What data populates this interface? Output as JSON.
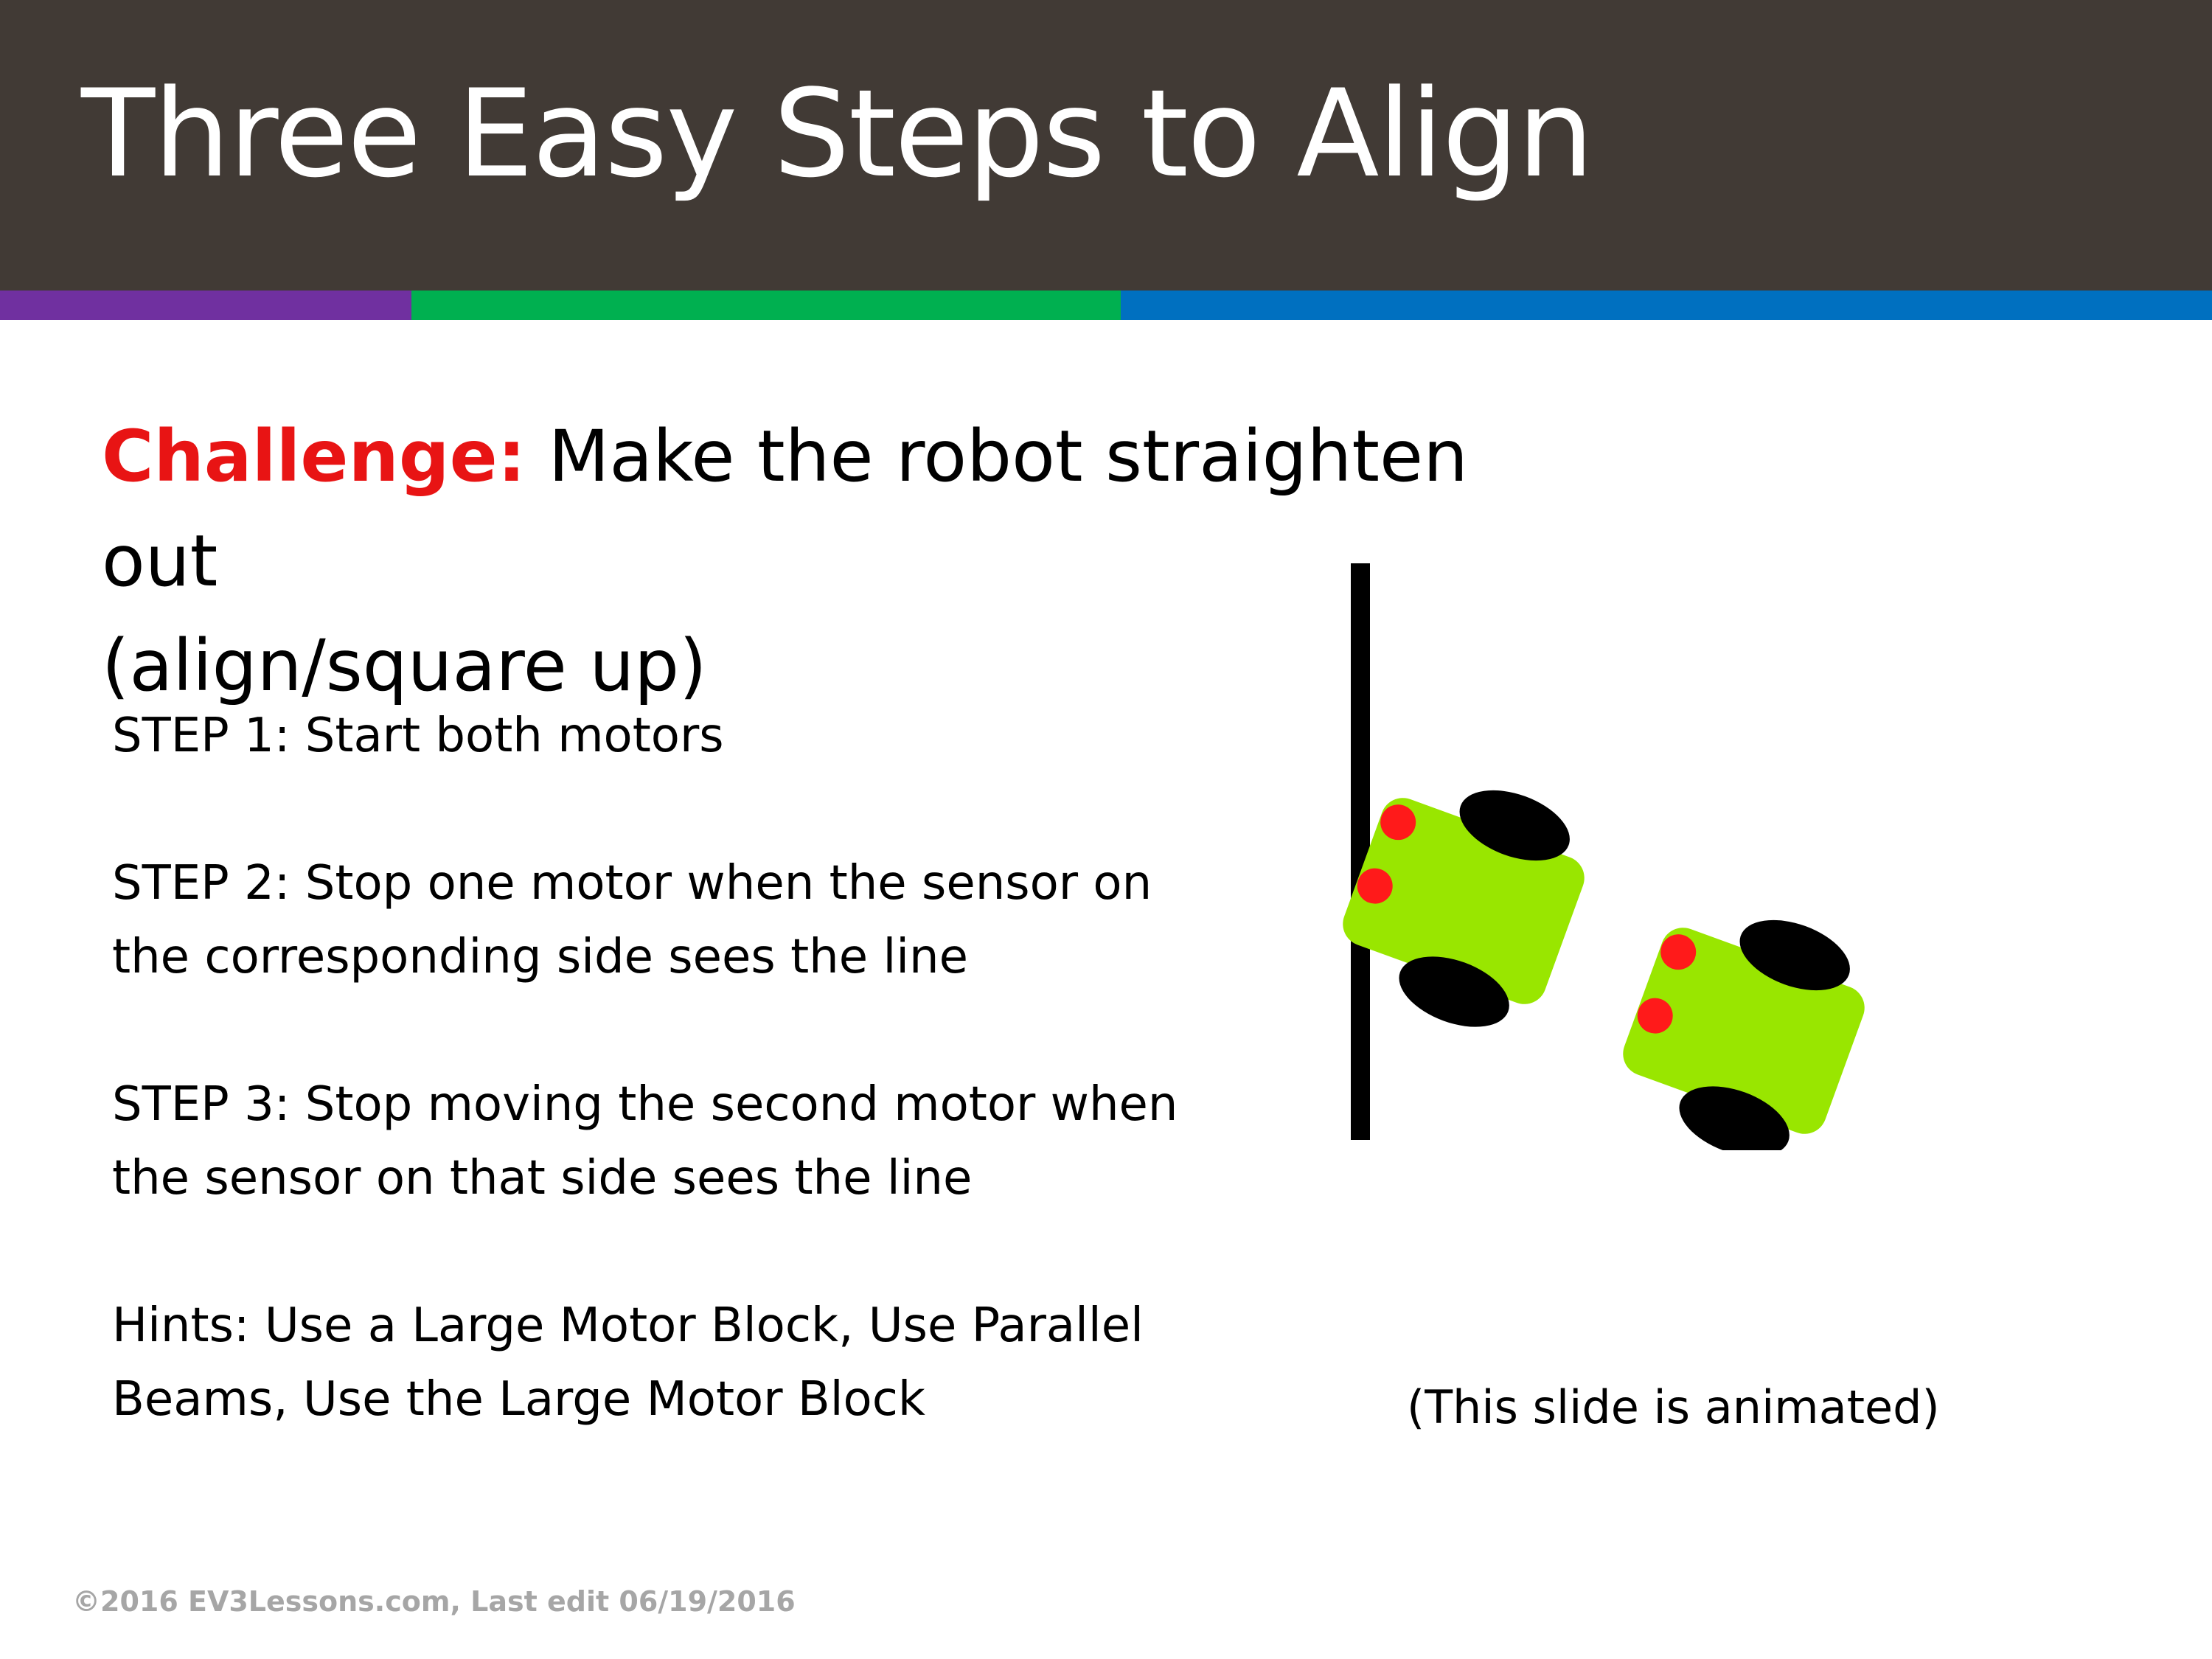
{
  "slide": {
    "title": "Three Easy Steps to Align",
    "challenge_label": "Challenge:",
    "challenge_text_line1": " Make the robot straighten out",
    "challenge_text_line2": "(align/square up)",
    "steps": [
      {
        "line1": "STEP 1: Start both motors",
        "line2": ""
      },
      {
        "line1": "STEP 2: Stop one motor when the sensor on",
        "line2": "the corresponding side sees the line"
      },
      {
        "line1": "STEP 3: Stop moving the second motor when",
        "line2": "the sensor on that side sees the line"
      },
      {
        "line1": "Hints: Use a Large Motor Block, Use Parallel",
        "line2": "Beams, Use the Large Motor Block"
      }
    ],
    "animation_note": "(This slide is animated)",
    "footer": "©2016 EV3Lessons.com, Last edit 06/19/2016"
  },
  "colors": {
    "header_bg": "#413a35",
    "stripe_purple": "#7030a0",
    "stripe_green": "#00b050",
    "stripe_blue": "#0070c0",
    "challenge_label": "#e81414",
    "robot_body": "#99e600",
    "wheel": "#000000",
    "sensor": "#ff1a1a",
    "line": "#000000"
  },
  "icons": {
    "robot": "robot-icon",
    "wheel": "wheel-icon",
    "sensor": "sensor-icon"
  }
}
